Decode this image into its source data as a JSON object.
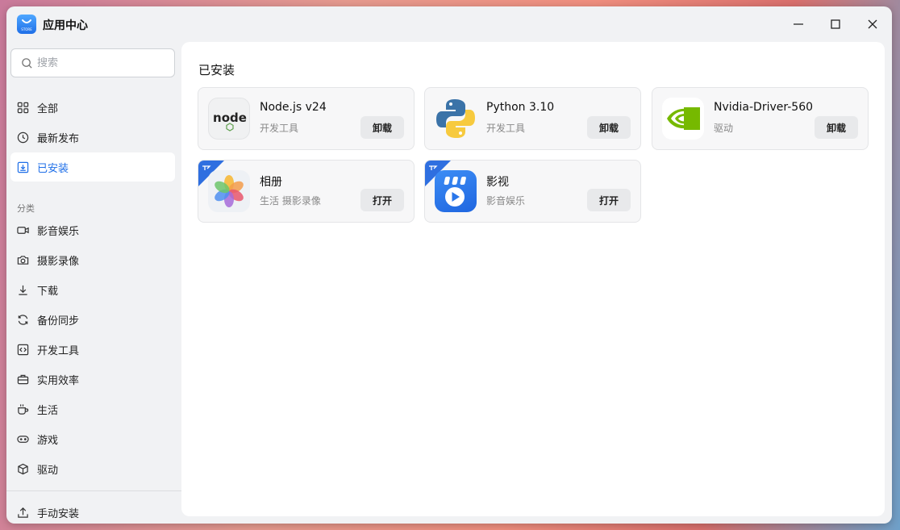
{
  "window": {
    "title": "应用中心",
    "logo_text": "STORE"
  },
  "search": {
    "placeholder": "搜索",
    "value": ""
  },
  "sidebar": {
    "top_items": [
      {
        "label": "全部",
        "icon": "grid-icon"
      },
      {
        "label": "最新发布",
        "icon": "clock-icon"
      },
      {
        "label": "已安装",
        "icon": "installed-icon",
        "active": true
      }
    ],
    "section_label": "分类",
    "categories": [
      {
        "label": "影音娱乐",
        "icon": "video-icon"
      },
      {
        "label": "摄影录像",
        "icon": "camera-icon"
      },
      {
        "label": "下载",
        "icon": "download-icon"
      },
      {
        "label": "备份同步",
        "icon": "sync-icon"
      },
      {
        "label": "开发工具",
        "icon": "code-icon"
      },
      {
        "label": "实用效率",
        "icon": "toolbox-icon"
      },
      {
        "label": "生活",
        "icon": "cup-icon"
      },
      {
        "label": "游戏",
        "icon": "gamepad-icon"
      },
      {
        "label": "驱动",
        "icon": "cube-icon"
      }
    ],
    "bottom_item": {
      "label": "手动安装",
      "icon": "upload-icon"
    }
  },
  "main": {
    "title": "已安装",
    "apps": [
      {
        "name": "Node.js v24",
        "category": "开发工具",
        "action": "卸载",
        "icon": "nodejs-icon",
        "icon_text": "node",
        "badge": false
      },
      {
        "name": "Python 3.10",
        "category": "开发工具",
        "action": "卸载",
        "icon": "python-icon",
        "badge": false
      },
      {
        "name": "Nvidia-Driver-560",
        "category": "驱动",
        "action": "卸载",
        "icon": "nvidia-icon",
        "badge": false
      },
      {
        "name": "相册",
        "category": "生活 摄影录像",
        "action": "打开",
        "icon": "photos-icon",
        "badge": true
      },
      {
        "name": "影视",
        "category": "影音娱乐",
        "action": "打开",
        "icon": "video-player-icon",
        "badge": true
      }
    ]
  },
  "colors": {
    "accent": "#1f6fe8",
    "badge": "#2f6fe0",
    "nvidia_green": "#76b900"
  }
}
